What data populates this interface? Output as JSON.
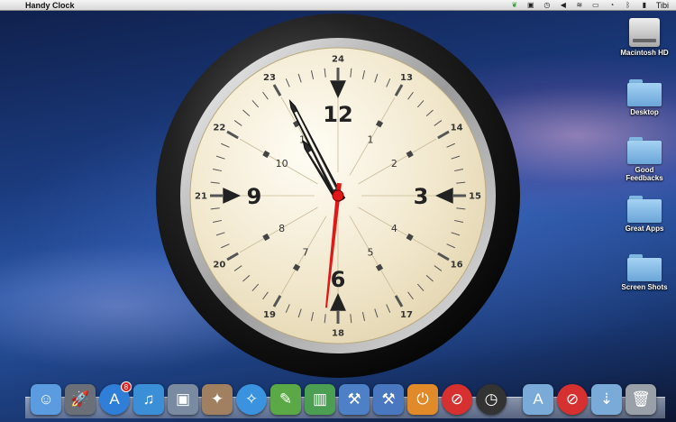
{
  "menubar": {
    "apple_glyph": "",
    "app_name": "Handy Clock",
    "status_icons": [
      "leaf-icon",
      "app-icon",
      "time-machine-icon",
      "volume-icon",
      "wifi-icon",
      "battery-icon",
      "clock-icon",
      "bluetooth-icon",
      "battery-level-icon"
    ],
    "user": "Tibi"
  },
  "desktop": {
    "icons": [
      {
        "label": "Macintosh HD",
        "kind": "hard-drive"
      },
      {
        "label": "Desktop",
        "kind": "folder"
      },
      {
        "label": "Good Feedbacks",
        "kind": "folder"
      },
      {
        "label": "Great Apps",
        "kind": "folder"
      },
      {
        "label": "Screen Shots",
        "kind": "folder"
      }
    ]
  },
  "clock": {
    "hour_numbers": [
      "12",
      "3",
      "6",
      "9"
    ],
    "small_numbers": [
      "1",
      "2",
      "4",
      "5",
      "7",
      "8",
      "10",
      "11"
    ],
    "outer_numbers": [
      "24",
      "13",
      "14",
      "15",
      "16",
      "17",
      "18",
      "19",
      "20",
      "21",
      "22",
      "23"
    ],
    "time": {
      "hours": 10,
      "minutes": 55,
      "seconds": 31
    },
    "colors": {
      "dial": "#f3ead4",
      "bezel": "#1a1a1a",
      "second_hand": "#e01818"
    }
  },
  "dock": {
    "items": [
      {
        "name": "finder-icon",
        "glyph": "☺",
        "bg": "#5b9be0"
      },
      {
        "name": "launchpad-icon",
        "glyph": "🚀",
        "bg": "#6a6f78"
      },
      {
        "name": "app-store-icon",
        "glyph": "A",
        "bg": "#2f7fd8",
        "badge": "8"
      },
      {
        "name": "itunes-icon",
        "glyph": "♫",
        "bg": "#3a8fd6"
      },
      {
        "name": "preview-icon",
        "glyph": "▣",
        "bg": "#7a8aa0"
      },
      {
        "name": "image-capture-icon",
        "glyph": "✦",
        "bg": "#a08060"
      },
      {
        "name": "safari-icon",
        "glyph": "✧",
        "bg": "#3b93e0"
      },
      {
        "name": "evernote-icon",
        "glyph": "✎",
        "bg": "#5aa846"
      },
      {
        "name": "numbers-icon",
        "glyph": "▥",
        "bg": "#4c9e52"
      },
      {
        "name": "xcode-icon",
        "glyph": "⚒",
        "bg": "#4e80c8"
      },
      {
        "name": "instruments-icon",
        "glyph": "⚒",
        "bg": "#4a78c0"
      },
      {
        "name": "app-icon",
        "glyph": "⏻",
        "bg": "#e08a2a"
      },
      {
        "name": "blocked-app-icon",
        "glyph": "⊘",
        "bg": "#d63030"
      },
      {
        "name": "clock-app-icon",
        "glyph": "◷",
        "bg": "#333333"
      },
      {
        "name": "applications-folder-icon",
        "glyph": "A",
        "bg": "#7aaad8"
      },
      {
        "name": "blocked-app-icon-2",
        "glyph": "⊘",
        "bg": "#d63030"
      },
      {
        "name": "downloads-folder-icon",
        "glyph": "⇣",
        "bg": "#7aaad8"
      },
      {
        "name": "trash-icon",
        "glyph": "🗑",
        "bg": "#9aa0a8"
      }
    ]
  }
}
